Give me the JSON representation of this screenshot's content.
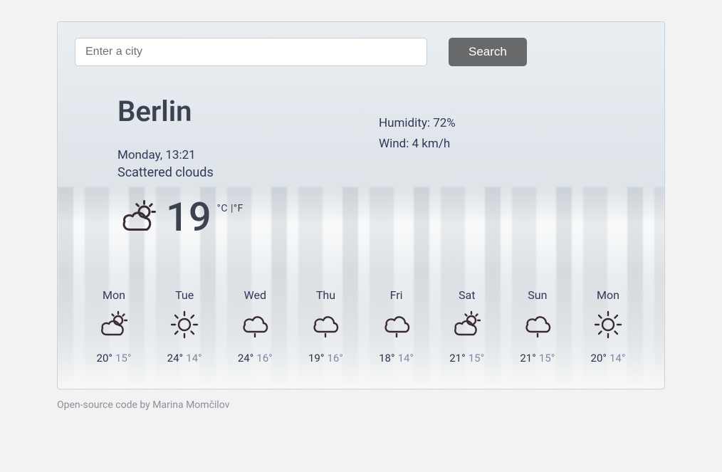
{
  "search": {
    "placeholder": "Enter a city",
    "button_label": "Search"
  },
  "current": {
    "city": "Berlin",
    "date_line": "Monday, 13:21",
    "description": "Scattered clouds",
    "temp": "19",
    "unit_c": "°C",
    "unit_sep": " |",
    "unit_f": "°F",
    "humidity_label": "Humidity: 72%",
    "wind_label": "Wind: 4 km/h",
    "icon": "partly-cloudy"
  },
  "forecast": [
    {
      "day": "Mon",
      "icon": "partly-cloudy",
      "high": "20°",
      "low": "15°"
    },
    {
      "day": "Tue",
      "icon": "sunny",
      "high": "24°",
      "low": "14°"
    },
    {
      "day": "Wed",
      "icon": "rain",
      "high": "24°",
      "low": "16°"
    },
    {
      "day": "Thu",
      "icon": "rain",
      "high": "19°",
      "low": "16°"
    },
    {
      "day": "Fri",
      "icon": "rain",
      "high": "18°",
      "low": "14°"
    },
    {
      "day": "Sat",
      "icon": "partly-cloudy",
      "high": "21°",
      "low": "15°"
    },
    {
      "day": "Sun",
      "icon": "rain",
      "high": "21°",
      "low": "15°"
    },
    {
      "day": "Mon",
      "icon": "sunny",
      "high": "20°",
      "low": "14°"
    }
  ],
  "footer": {
    "prefix": "Open-source code ",
    "by": "by Marina Momčilov"
  }
}
